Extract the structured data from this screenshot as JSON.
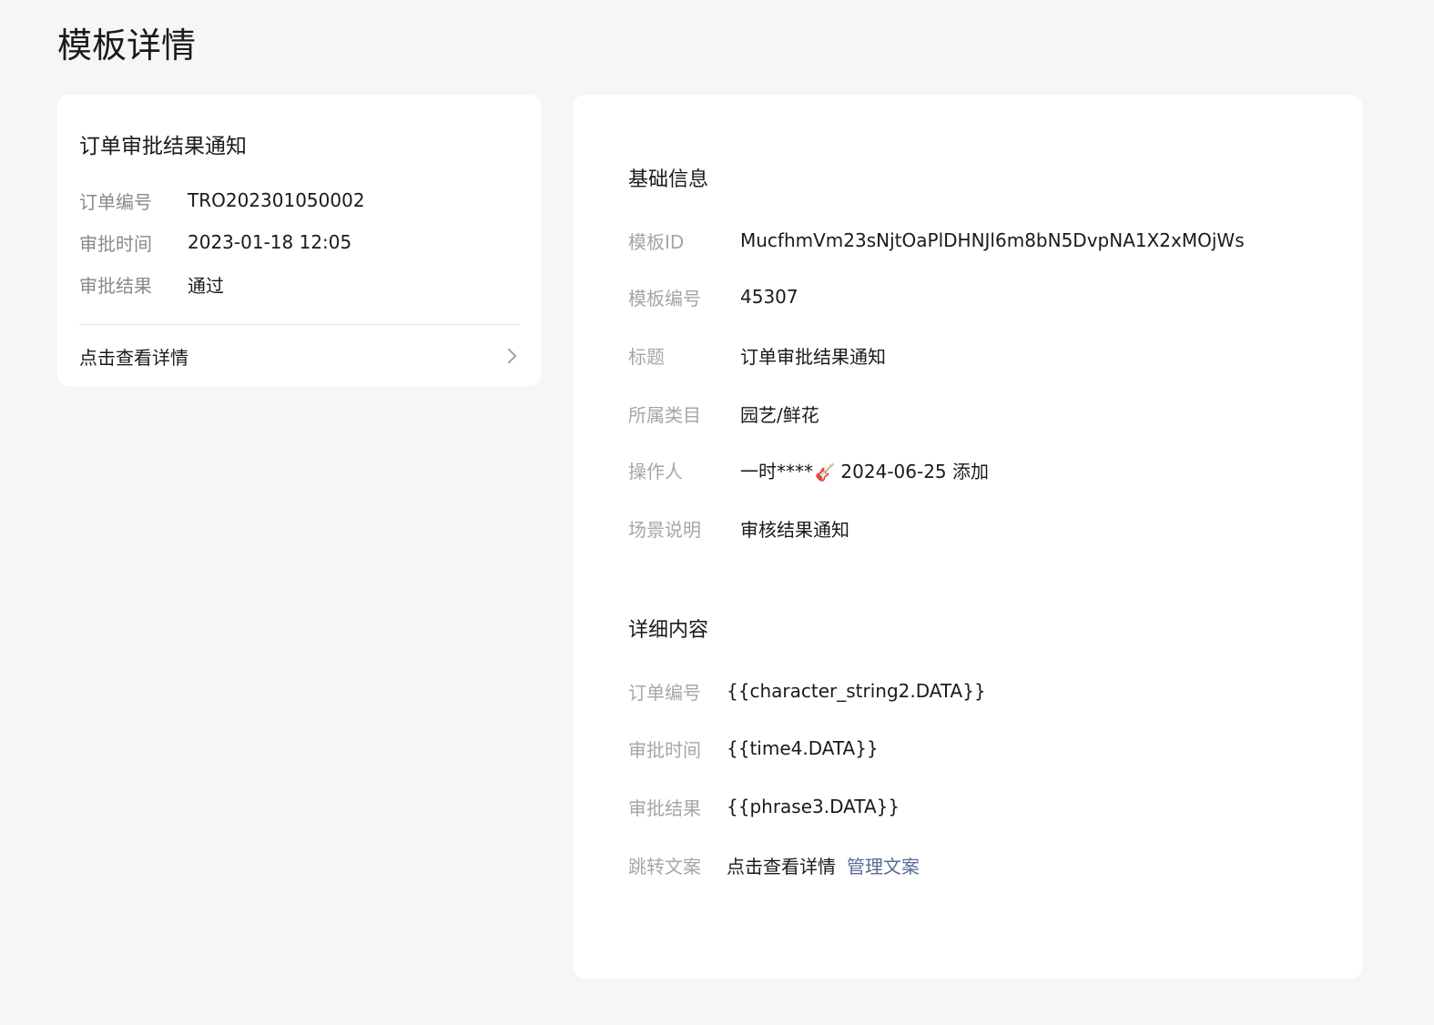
{
  "page": {
    "title": "模板详情"
  },
  "preview": {
    "title": "订单审批结果通知",
    "rows": [
      {
        "label": "订单编号",
        "value": "TRO202301050002"
      },
      {
        "label": "审批时间",
        "value": "2023-01-18 12:05"
      },
      {
        "label": "审批结果",
        "value": "通过"
      }
    ],
    "link_label": "点击查看详情",
    "link_icon": "chevron-right-icon"
  },
  "basic_info": {
    "section_title": "基础信息",
    "rows": [
      {
        "label": "模板ID",
        "value": "MucfhmVm23sNjtOaPlDHNJl6m8bN5DvpNA1X2xMOjWs"
      },
      {
        "label": "模板编号",
        "value": "45307"
      },
      {
        "label": "标题",
        "value": "订单审批结果通知"
      },
      {
        "label": "所属类目",
        "value": "园艺/鲜花"
      },
      {
        "label": "操作人",
        "value_name": "一时****",
        "value_emoji": "🎸",
        "value_date": "2024-06-25 添加"
      },
      {
        "label": "场景说明",
        "value": "审核结果通知"
      }
    ]
  },
  "detail_content": {
    "section_title": "详细内容",
    "rows": [
      {
        "label": "订单编号",
        "value": "{{character_string2.DATA}}"
      },
      {
        "label": "审批时间",
        "value": "{{time4.DATA}}"
      },
      {
        "label": "审批结果",
        "value": "{{phrase3.DATA}}"
      },
      {
        "label": "跳转文案",
        "value": "点击查看详情",
        "action": "管理文案"
      }
    ]
  },
  "colors": {
    "background": "#f5f6f7",
    "card": "#ffffff",
    "label_gray": "#a6a6a6",
    "link_blue": "#576b95"
  }
}
